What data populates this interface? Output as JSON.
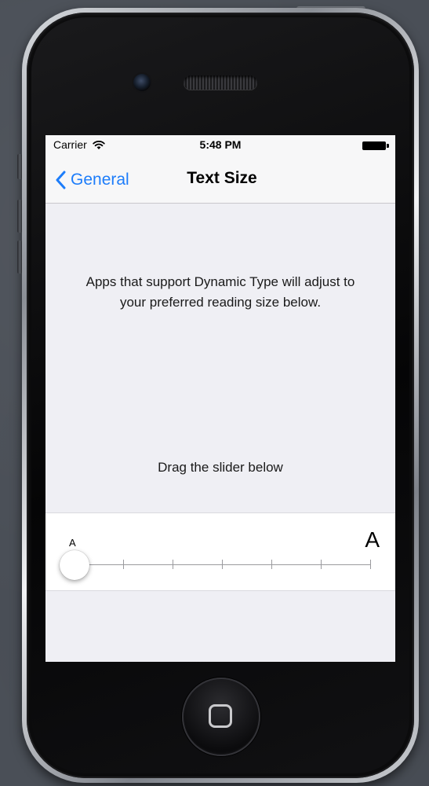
{
  "status_bar": {
    "carrier": "Carrier",
    "time": "5:48 PM",
    "wifi_icon": "wifi-icon",
    "battery_icon": "battery-icon"
  },
  "nav": {
    "back_label": "General",
    "back_icon": "chevron-left-icon",
    "title": "Text Size"
  },
  "content": {
    "description": "Apps that support Dynamic Type will adjust to your preferred reading size below.",
    "hint": "Drag the slider below"
  },
  "slider": {
    "min_label": "A",
    "max_label": "A",
    "value": 0,
    "steps": 7
  },
  "colors": {
    "accent": "#1d7dfa",
    "background": "#efeff4"
  }
}
